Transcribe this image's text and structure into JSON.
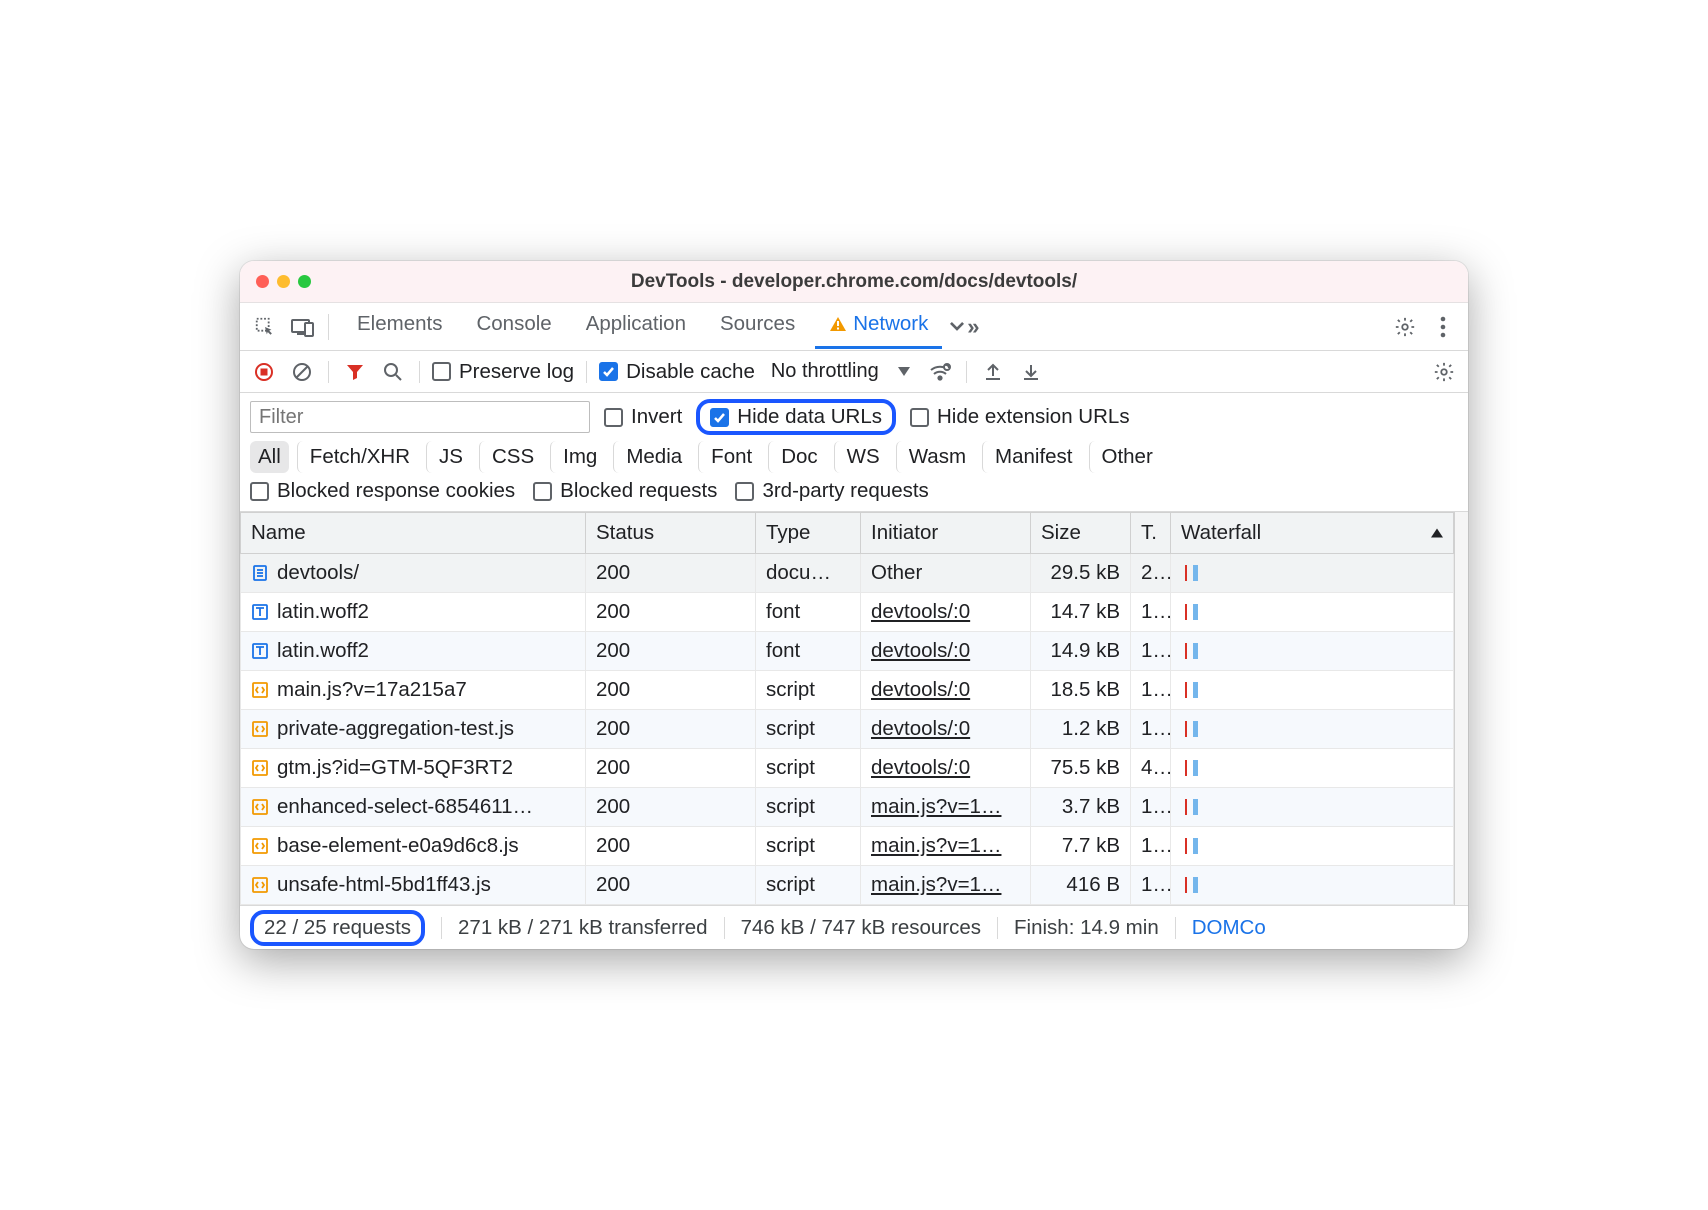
{
  "window": {
    "title": "DevTools - developer.chrome.com/docs/devtools/"
  },
  "tabs": {
    "items": [
      "Elements",
      "Console",
      "Application",
      "Sources",
      "Network"
    ],
    "active": "Network"
  },
  "netToolbar": {
    "preserveLog": {
      "label": "Preserve log",
      "checked": false
    },
    "disableCache": {
      "label": "Disable cache",
      "checked": true
    },
    "throttling": {
      "label": "No throttling"
    }
  },
  "filterBar": {
    "filterPlaceholder": "Filter",
    "invert": {
      "label": "Invert",
      "checked": false
    },
    "hideDataUrls": {
      "label": "Hide data URLs",
      "checked": true
    },
    "hideExtUrls": {
      "label": "Hide extension URLs",
      "checked": false
    },
    "types": [
      "All",
      "Fetch/XHR",
      "JS",
      "CSS",
      "Img",
      "Media",
      "Font",
      "Doc",
      "WS",
      "Wasm",
      "Manifest",
      "Other"
    ],
    "selectedType": "All",
    "blockedCookies": {
      "label": "Blocked response cookies",
      "checked": false
    },
    "blockedRequests": {
      "label": "Blocked requests",
      "checked": false
    },
    "thirdParty": {
      "label": "3rd-party requests",
      "checked": false
    }
  },
  "columns": {
    "name": "Name",
    "status": "Status",
    "type": "Type",
    "initiator": "Initiator",
    "size": "Size",
    "time": "T.",
    "waterfall": "Waterfall"
  },
  "rows": [
    {
      "icon": "doc",
      "name": "devtools/",
      "status": "200",
      "type": "docu…",
      "initiator": "Other",
      "initLink": false,
      "size": "29.5 kB",
      "time": "2..",
      "sel": true
    },
    {
      "icon": "font",
      "name": "latin.woff2",
      "status": "200",
      "type": "font",
      "initiator": "devtools/:0",
      "initLink": true,
      "size": "14.7 kB",
      "time": "1.."
    },
    {
      "icon": "font",
      "name": "latin.woff2",
      "status": "200",
      "type": "font",
      "initiator": "devtools/:0",
      "initLink": true,
      "size": "14.9 kB",
      "time": "1..",
      "alt": true
    },
    {
      "icon": "script",
      "name": "main.js?v=17a215a7",
      "status": "200",
      "type": "script",
      "initiator": "devtools/:0",
      "initLink": true,
      "size": "18.5 kB",
      "time": "1.."
    },
    {
      "icon": "script",
      "name": "private-aggregation-test.js",
      "status": "200",
      "type": "script",
      "initiator": "devtools/:0",
      "initLink": true,
      "size": "1.2 kB",
      "time": "1..",
      "alt": true
    },
    {
      "icon": "script",
      "name": "gtm.js?id=GTM-5QF3RT2",
      "status": "200",
      "type": "script",
      "initiator": "devtools/:0",
      "initLink": true,
      "size": "75.5 kB",
      "time": "4.."
    },
    {
      "icon": "script",
      "name": "enhanced-select-6854611…",
      "status": "200",
      "type": "script",
      "initiator": "main.js?v=1…",
      "initLink": true,
      "size": "3.7 kB",
      "time": "1..",
      "alt": true
    },
    {
      "icon": "script",
      "name": "base-element-e0a9d6c8.js",
      "status": "200",
      "type": "script",
      "initiator": "main.js?v=1…",
      "initLink": true,
      "size": "7.7 kB",
      "time": "1.."
    },
    {
      "icon": "script",
      "name": "unsafe-html-5bd1ff43.js",
      "status": "200",
      "type": "script",
      "initiator": "main.js?v=1…",
      "initLink": true,
      "size": "416 B",
      "time": "1..",
      "alt": true
    }
  ],
  "status": {
    "requests": "22 / 25 requests",
    "transferred": "271 kB / 271 kB transferred",
    "resources": "746 kB / 747 kB resources",
    "finish": "Finish: 14.9 min",
    "dom": "DOMCo"
  }
}
